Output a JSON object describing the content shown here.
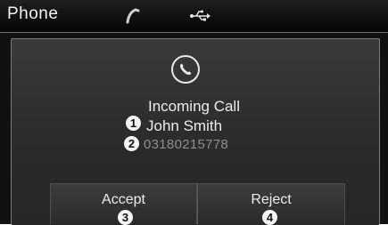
{
  "statusbar": {
    "title": "Phone",
    "icons": [
      "bluetooth-call-icon",
      "usb-icon"
    ]
  },
  "call": {
    "icon": "phone-icon",
    "status": "Incoming Call",
    "name": "John Smith",
    "number": "03180215778"
  },
  "buttons": {
    "accept": "Accept",
    "reject": "Reject"
  },
  "callouts": {
    "name": "1",
    "number": "2",
    "accept": "3",
    "reject": "4"
  },
  "colors": {
    "background": "#111111",
    "dialog": "#333333",
    "text": "#ececec",
    "number_text": "#8e8e8e"
  }
}
